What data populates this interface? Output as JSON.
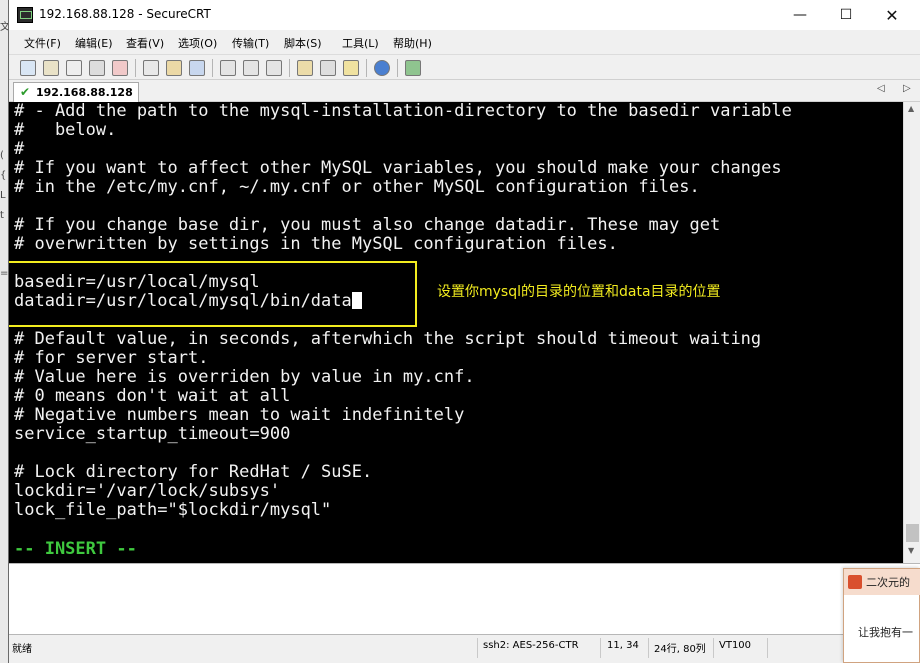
{
  "window": {
    "title": "192.168.88.128 - SecureCRT",
    "minimize_glyph": "—",
    "maximize_glyph": "☐",
    "close_glyph": "✕"
  },
  "menu": {
    "items": [
      "文件(F)",
      "编辑(E)",
      "查看(V)",
      "选项(O)",
      "传输(T)",
      "脚本(S)",
      "工具(L)",
      "帮助(H)"
    ]
  },
  "toolbar": {
    "icons": [
      "connect-icon",
      "quick-connect-icon",
      "connect-tab-icon",
      "reconnect-icon",
      "disconnect-icon",
      "copy-icon",
      "paste-icon",
      "find-icon",
      "print-icon",
      "print-screen-icon",
      "print-setup-icon",
      "session-options-icon",
      "global-options-icon",
      "key-icon",
      "help-icon",
      "map-icon"
    ]
  },
  "tab": {
    "label": "192.168.88.128",
    "check_glyph": "✔",
    "nav_left_glyph": "◁",
    "nav_right_glyph": "▷"
  },
  "terminal": {
    "lines": [
      "# - Add the path to the mysql-installation-directory to the basedir variable",
      "#   below.",
      "#",
      "# If you want to affect other MySQL variables, you should make your changes",
      "# in the /etc/my.cnf, ~/.my.cnf or other MySQL configuration files.",
      "",
      "# If you change base dir, you must also change datadir. These may get",
      "# overwritten by settings in the MySQL configuration files.",
      "",
      "basedir=/usr/local/mysql",
      "datadir=/usr/local/mysql/bin/data",
      "",
      "# Default value, in seconds, afterwhich the script should timeout waiting",
      "# for server start.",
      "# Value here is overriden by value in my.cnf.",
      "# 0 means don't wait at all",
      "# Negative numbers mean to wait indefinitely",
      "service_startup_timeout=900",
      "",
      "# Lock directory for RedHat / SuSE.",
      "lockdir='/var/lock/subsys'",
      "lock_file_path=\"$lockdir/mysql\"",
      ""
    ],
    "mode_line": "-- INSERT --",
    "annotation": "设置你mysql的目录的位置和data目录的位置",
    "colors": {
      "background": "#000000",
      "text": "#f2f2f2",
      "insert": "#3fc93f",
      "annotation": "#f2ec1f"
    }
  },
  "status": {
    "ready": "就绪",
    "cipher": "ssh2: AES-256-CTR",
    "cursor_pos": "11, 34",
    "size": "24行, 80列",
    "terminal_type": "VT100"
  },
  "popup": {
    "title": "二次元的",
    "text": "让我抱有一"
  },
  "background": {
    "fragments": [
      "文",
      "(",
      "{",
      "L",
      "t",
      "="
    ]
  }
}
